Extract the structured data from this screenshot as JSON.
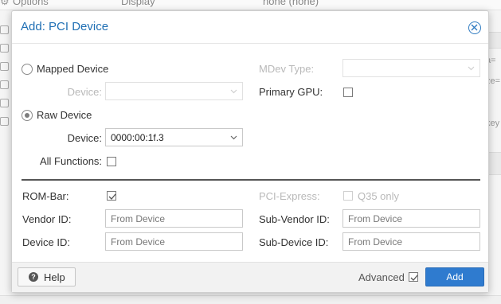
{
  "background": {
    "options_label": "Options",
    "display_label": "Display",
    "display_value": "none (none)",
    "right_fragments": [
      "a=",
      "ze=",
      "key"
    ]
  },
  "dialog": {
    "title": "Add: PCI Device",
    "mapped_device": {
      "label": "Mapped Device",
      "selected": false,
      "device_label": "Device:",
      "device_value": ""
    },
    "mdev_type": {
      "label": "MDev Type:",
      "value": ""
    },
    "primary_gpu": {
      "label": "Primary GPU:",
      "checked": false
    },
    "raw_device": {
      "label": "Raw Device",
      "selected": true,
      "device_label": "Device:",
      "device_value": "0000:00:1f.3"
    },
    "all_functions": {
      "label": "All Functions:",
      "checked": false
    },
    "rom_bar": {
      "label": "ROM-Bar:",
      "checked": true
    },
    "pci_express": {
      "label": "PCI-Express:",
      "q35_label": "Q35 only",
      "checked": false
    },
    "vendor_id": {
      "label": "Vendor ID:",
      "placeholder": "From Device"
    },
    "sub_vendor_id": {
      "label": "Sub-Vendor ID:",
      "placeholder": "From Device"
    },
    "device_id": {
      "label": "Device ID:",
      "placeholder": "From Device"
    },
    "sub_device_id": {
      "label": "Sub-Device ID:",
      "placeholder": "From Device"
    }
  },
  "footer": {
    "help_label": "Help",
    "advanced_label": "Advanced",
    "advanced_checked": true,
    "add_label": "Add"
  },
  "colors": {
    "title": "#1f6fb4",
    "primary_button": "#2f7bcf",
    "disabled_text": "#b9b9b9"
  },
  "icons": [
    "close-icon",
    "chevron-down-icon",
    "checkmark-icon",
    "help-icon",
    "gear-icon"
  ]
}
